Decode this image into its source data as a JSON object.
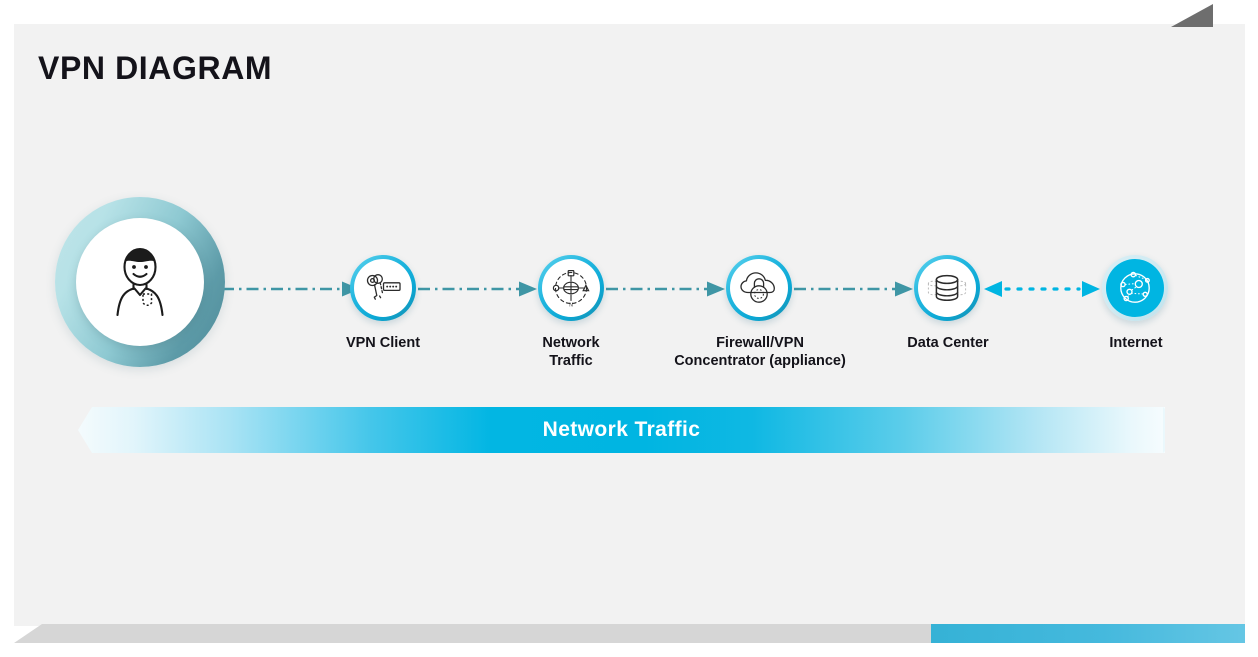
{
  "slide": {
    "title": "VPN DIAGRAM",
    "background_color": "#f2f2f2",
    "page_color": "#ffffff",
    "accent_color": "#00b5e2",
    "teal_color": "#3f96a5",
    "corner_triangle_color": "#6e6e6e",
    "bottom_band_color": "#d6d6d6"
  },
  "flow": {
    "start_node": {
      "name": "user-avatar",
      "icon": "person-avatar-icon"
    },
    "nodes": [
      {
        "id": "vpn-client",
        "label": "VPN Client",
        "icon": "key-password-icon",
        "label_lines": [
          "VPN Client"
        ]
      },
      {
        "id": "network-traffic",
        "label": "Network Traffic",
        "icon": "network-hub-icon",
        "label_lines": [
          "Network",
          "Traffic"
        ]
      },
      {
        "id": "firewall-vpn",
        "label": "Firewall/VPN Concentrator (appliance)",
        "icon": "cloud-lock-icon",
        "label_lines": [
          "Firewall/VPN",
          "Concentrator (appliance)"
        ]
      },
      {
        "id": "data-center",
        "label": "Data Center",
        "icon": "database-server-icon",
        "label_lines": [
          "Data Center"
        ]
      },
      {
        "id": "internet",
        "label": "Internet",
        "icon": "globe-network-icon",
        "label_lines": [
          "Internet"
        ]
      }
    ],
    "connectors": [
      {
        "from": "user-avatar",
        "to": "vpn-client",
        "style": "dash-dot",
        "direction": "right",
        "color": "#3f96a5"
      },
      {
        "from": "vpn-client",
        "to": "network-traffic",
        "style": "dash-dot",
        "direction": "right",
        "color": "#3f96a5"
      },
      {
        "from": "network-traffic",
        "to": "firewall-vpn",
        "style": "dash-dot",
        "direction": "right",
        "color": "#3f96a5"
      },
      {
        "from": "firewall-vpn",
        "to": "data-center",
        "style": "dash-dot",
        "direction": "right",
        "color": "#3f96a5"
      },
      {
        "from": "data-center",
        "to": "internet",
        "style": "dotted",
        "direction": "bidirectional",
        "color": "#00b5e2"
      }
    ]
  },
  "banner": {
    "label": "Network  Traffic",
    "gradient_start": "#f4fbfd",
    "gradient_mid": "#00b5e2",
    "gradient_end": "#f6fcfe"
  }
}
